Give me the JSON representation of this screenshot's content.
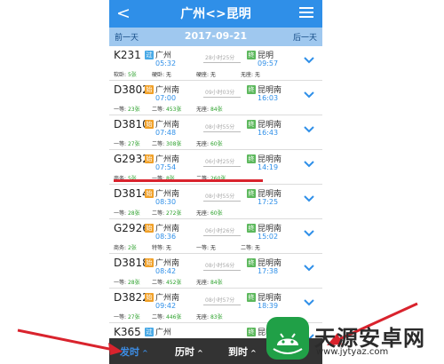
{
  "app": {
    "back_glyph": "<",
    "title": "广州<>昆明",
    "menu_icon": "menu-icon"
  },
  "datebar": {
    "prev_label": "前一天",
    "date": "2017-09-21",
    "next_label": "后一天"
  },
  "trains": [
    {
      "no": "K231",
      "from": "广州",
      "from_badge": "过",
      "dep": "05:32",
      "dur": "28小时25分",
      "to": "昆明",
      "to_badge": "终",
      "arr": "09:57",
      "seats": [
        "软卧: 5张",
        "硬卧: 无",
        "硬座: 无",
        "无座: 无"
      ]
    },
    {
      "no": "D3802",
      "from": "广州南",
      "from_badge": "始",
      "dep": "07:00",
      "dur": "09小时03分",
      "to": "昆明南",
      "to_badge": "终",
      "arr": "16:03",
      "seats": [
        "一等: 23张",
        "二等: 453张",
        "无座: 84张",
        ""
      ]
    },
    {
      "no": "D3810",
      "from": "广州南",
      "from_badge": "始",
      "dep": "07:48",
      "dur": "08小时55分",
      "to": "昆明南",
      "to_badge": "终",
      "arr": "16:43",
      "seats": [
        "一等: 27张",
        "二等: 308张",
        "无座: 60张",
        ""
      ]
    },
    {
      "no": "G2932",
      "from": "广州南",
      "from_badge": "始",
      "dep": "07:54",
      "dur": "06小时25分",
      "to": "昆明南",
      "to_badge": "终",
      "arr": "14:19",
      "seats": [
        "商务: 5张",
        "一等: 8张",
        "二等: 260张",
        ""
      ]
    },
    {
      "no": "D3814",
      "from": "广州南",
      "from_badge": "始",
      "dep": "08:30",
      "dur": "08小时55分",
      "to": "昆明南",
      "to_badge": "终",
      "arr": "17:25",
      "seats": [
        "一等: 28张",
        "二等: 272张",
        "无座: 60张",
        ""
      ]
    },
    {
      "no": "G2926",
      "from": "广州南",
      "from_badge": "始",
      "dep": "08:36",
      "dur": "06小时26分",
      "to": "昆明南",
      "to_badge": "终",
      "arr": "15:02",
      "seats": [
        "商务: 2张",
        "特等: 无",
        "一等: 无",
        "二等: 无"
      ]
    },
    {
      "no": "D3818",
      "from": "广州南",
      "from_badge": "始",
      "dep": "08:42",
      "dur": "08小时56分",
      "to": "昆明南",
      "to_badge": "终",
      "arr": "17:38",
      "seats": [
        "一等: 28张",
        "二等: 452张",
        "无座: 84张",
        ""
      ]
    },
    {
      "no": "D3822",
      "from": "广州南",
      "from_badge": "始",
      "dep": "09:42",
      "dur": "08小时57分",
      "to": "昆明南",
      "to_badge": "终",
      "arr": "18:39",
      "seats": [
        "一等: 27张",
        "二等: 446张",
        "无座: 83张",
        ""
      ]
    },
    {
      "no": "K365",
      "from": "广州",
      "from_badge": "过",
      "dep": "",
      "dur": "",
      "to": "昆明",
      "to_badge": "终",
      "arr": "",
      "seats": [
        "",
        "",
        "",
        ""
      ]
    }
  ],
  "bottom_tabs": {
    "departure": "发时",
    "duration": "历时",
    "arrival": "到时"
  },
  "watermark": {
    "name": "天源安卓网",
    "url": "www.jytyaz.com"
  },
  "colors": {
    "header_blue": "#2f8fe8",
    "datebar_blue": "#9fc8ef",
    "origin_badge_orange": "#f0a028",
    "pass_badge_blue": "#48a9e6",
    "terminal_badge_green": "#5cb85c",
    "seat_count_green": "#2aa02a",
    "annotation_red": "#d9232d",
    "bottom_bar": "#333333"
  }
}
